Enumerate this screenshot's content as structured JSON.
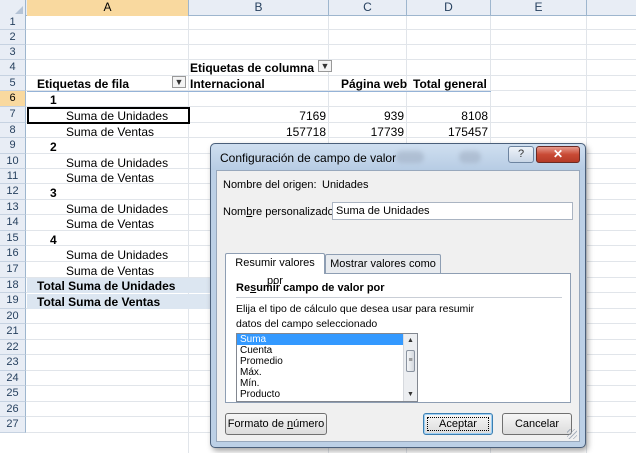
{
  "sheet": {
    "columns": [
      "A",
      "B",
      "C",
      "D",
      "E"
    ],
    "rows": [
      "1",
      "2",
      "3",
      "4",
      "5",
      "6",
      "7",
      "8",
      "9",
      "10",
      "11",
      "12",
      "13",
      "14",
      "15",
      "16",
      "17",
      "18",
      "19",
      "20",
      "21",
      "22",
      "23",
      "24",
      "25",
      "26",
      "27"
    ],
    "active_column": "A",
    "active_row": "6",
    "cells": {
      "col_labels": "Etiquetas de columna",
      "row_labels": "Etiquetas de fila",
      "international": "Internacional",
      "web_page": "Página web",
      "grand_total": "Total general",
      "group_1": "1",
      "group_2": "2",
      "group_3": "3",
      "group_4": "4",
      "sum_units": "Suma de Unidades",
      "sum_sales": "Suma de Ventas",
      "units_intl": "7169",
      "units_web": "939",
      "units_total": "8108",
      "sales_intl": "157718",
      "sales_web": "17739",
      "sales_total": "175457",
      "total_sum_units": "Total Suma de Unidades",
      "total_sum_sales": "Total Suma de Ventas"
    },
    "filter_icon": "filter-dropdown-icon",
    "dropdown_icon": "dropdown-arrow-icon"
  },
  "dialog": {
    "title": "Configuración de campo de valor",
    "help_glyph": "?",
    "close_glyph": "✕",
    "source_label": "Nombre del origen:",
    "source_value": "Unidades",
    "custom_name_prefix": "Nom",
    "custom_name_underlined": "b",
    "custom_name_suffix": "re personalizado:",
    "custom_name_value": "Suma de Unidades",
    "tabs": [
      {
        "label": "Resumir valores por",
        "active": true
      },
      {
        "label": "Mostrar valores como",
        "active": false
      }
    ],
    "section_prefix": "Re",
    "section_underlined": "s",
    "section_suffix": "umir campo de valor por",
    "instructions_line1": "Elija el tipo de cálculo que desea usar para resumir",
    "instructions_line2": "datos del campo seleccionado",
    "list_options": [
      "Suma",
      "Cuenta",
      "Promedio",
      "Máx.",
      "Mín.",
      "Producto"
    ],
    "selected_option": "Suma",
    "number_format_prefix": "Formato de ",
    "number_format_underlined": "n",
    "number_format_suffix": "úmero",
    "accept": "Aceptar",
    "cancel": "Cancelar"
  }
}
